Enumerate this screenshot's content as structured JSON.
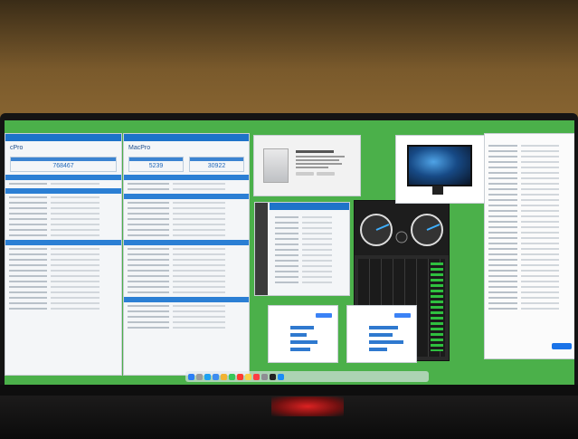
{
  "geekbench_left": {
    "title": "cPro",
    "score": "768467"
  },
  "geekbench_right": {
    "title": "MacPro",
    "single_core_score": "5239",
    "multi_core_score": "30922"
  },
  "colors": {
    "desktop": "#4bb04a",
    "window_header": "#1e73c9",
    "score_text": "#1e66b8",
    "disk_speed_bg": "#2a2a2a",
    "wall": "#7a5a2c"
  },
  "dock_icons": [
    "finder-icon",
    "launchpad-icon",
    "safari-icon",
    "mail-icon",
    "photos-icon",
    "messages-icon",
    "calendar-icon",
    "notes-icon",
    "music-icon",
    "settings-icon",
    "terminal-icon",
    "appstore-icon"
  ]
}
